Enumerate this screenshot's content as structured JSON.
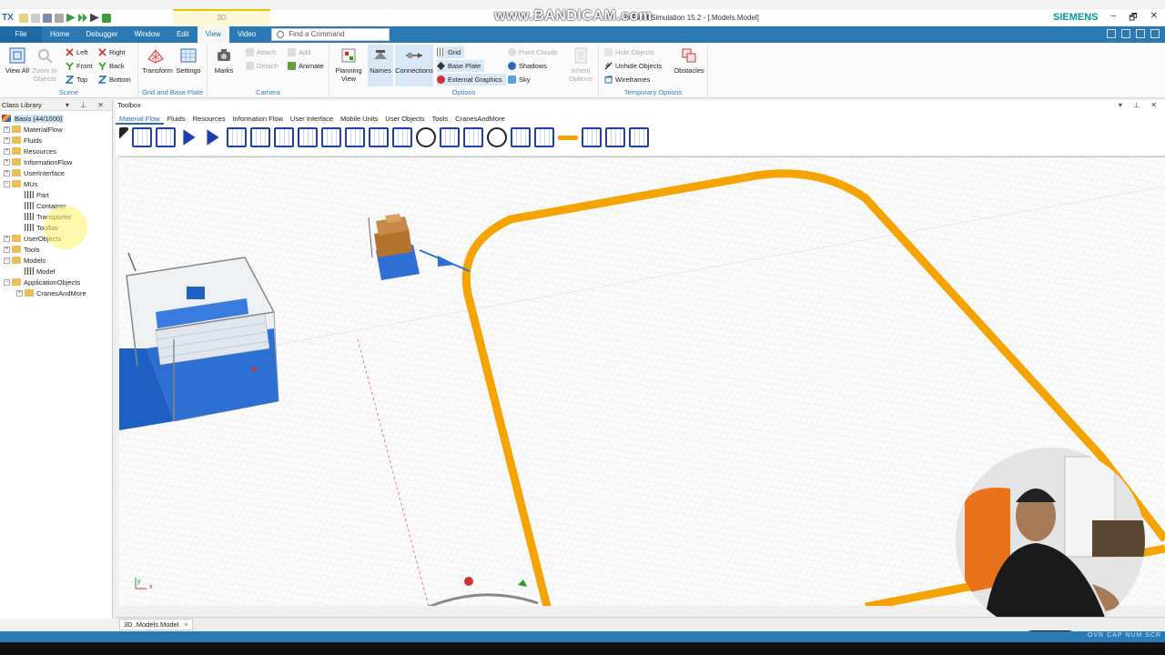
{
  "titlebar": {
    "app_mark": "TX",
    "context_tab": "3D",
    "title": "...ix Plant Simulation 15.2 - [.Models.Model]",
    "watermark": "www.BANDICAM.com",
    "brand": "SIEMENS",
    "win_minimize": "–",
    "win_restore": "🗗",
    "win_close": "✕"
  },
  "tabs": [
    "File",
    "Home",
    "Debugger",
    "Window",
    "Edit",
    "View",
    "Video"
  ],
  "active_tab": "View",
  "search": {
    "placeholder": "Find a Command"
  },
  "ribbon": {
    "scene": {
      "label": "Scene",
      "view_all": "View All",
      "zoom_objects": "Zoom to Objects",
      "left": "Left",
      "front": "Front",
      "top": "Top",
      "right": "Right",
      "back": "Back",
      "bottom": "Bottom"
    },
    "grid": {
      "label": "Grid and Base Plate",
      "transform": "Transform",
      "settings": "Settings"
    },
    "camera": {
      "label": "Camera",
      "marks": "Marks",
      "attach": "Attach",
      "detach": "Detach",
      "add": "Add",
      "animate": "Animate"
    },
    "options": {
      "label": "Options",
      "planning_view": "Planning View",
      "names": "Names",
      "connections": "Connections",
      "grid": "Grid",
      "base_plate": "Base Plate",
      "external_graphics": "External Graphics",
      "point_clouds": "Point Clouds",
      "shadows": "Shadows",
      "sky": "Sky",
      "inherit_options": "Inherit Options"
    },
    "temp": {
      "label": "Temporary Options",
      "hide_objects": "Hide Objects",
      "unhide_objects": "Unhide Objects",
      "wireframes": "Wireframes",
      "obstacles": "Obstacles"
    }
  },
  "class_library": {
    "title": "Class Library",
    "root": "Basis (44/1000)",
    "items": [
      {
        "label": "MaterialFlow",
        "level": 1,
        "kind": "folder",
        "exp": "+"
      },
      {
        "label": "Fluids",
        "level": 1,
        "kind": "folder",
        "exp": "+"
      },
      {
        "label": "Resources",
        "level": 1,
        "kind": "folder",
        "exp": "+"
      },
      {
        "label": "InformationFlow",
        "level": 1,
        "kind": "folder",
        "exp": "+"
      },
      {
        "label": "UserInterface",
        "level": 1,
        "kind": "folder",
        "exp": "+"
      },
      {
        "label": "MUs",
        "level": 1,
        "kind": "folder",
        "exp": "−"
      },
      {
        "label": "Part",
        "level": 2,
        "kind": "obj"
      },
      {
        "label": "Container",
        "level": 2,
        "kind": "obj"
      },
      {
        "label": "Transporter",
        "level": 2,
        "kind": "obj"
      },
      {
        "label": "Toolbar",
        "level": 2,
        "kind": "obj"
      },
      {
        "label": "UserObjects",
        "level": 1,
        "kind": "folder",
        "exp": "+"
      },
      {
        "label": "Tools",
        "level": 1,
        "kind": "folder",
        "exp": "+"
      },
      {
        "label": "Models",
        "level": 1,
        "kind": "folder",
        "exp": "−"
      },
      {
        "label": "Model",
        "level": 2,
        "kind": "obj"
      },
      {
        "label": "ApplicationObjects",
        "level": 1,
        "kind": "folder",
        "exp": "−"
      },
      {
        "label": "CranesAndMore",
        "level": 2,
        "kind": "folder",
        "exp": "+"
      }
    ]
  },
  "toolbox": {
    "title": "Toolbox",
    "tabs": [
      "Material Flow",
      "Fluids",
      "Resources",
      "Information Flow",
      "User Interface",
      "Mobile Units",
      "User Objects",
      "Tools",
      "CranesAndMore"
    ],
    "active": "Material Flow"
  },
  "document_tab": {
    "label": "3D .Models.Model",
    "close": "×"
  },
  "status": {
    "indicators": "OVR CAP NUM SCR"
  },
  "colors": {
    "ribbon_blue": "#2b7ab5",
    "track_orange": "#f5a300",
    "machine_blue": "#2e6fd4",
    "brand_teal": "#009999"
  }
}
